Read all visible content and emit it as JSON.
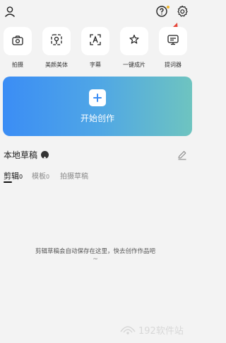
{
  "colors": {
    "background": "#f3f3f3",
    "card_gradient_start": "#3b8df5",
    "card_gradient_end": "#6ec4c0",
    "arrow": "#e5463a",
    "notification_dot": "#f0b52d"
  },
  "top_icons": [
    "user-icon",
    "help-icon",
    "gear-icon"
  ],
  "tools": [
    {
      "label": "拍摄",
      "icon": "camera-icon"
    },
    {
      "label": "美颜美体",
      "icon": "beauty-icon"
    },
    {
      "label": "字幕",
      "icon": "subtitle-icon"
    },
    {
      "label": "一键成片",
      "icon": "magic-icon"
    },
    {
      "label": "提词器",
      "icon": "teleprompter-icon"
    }
  ],
  "create": {
    "label": "开始创作",
    "icon": "plus-icon"
  },
  "drafts": {
    "title": "本地草稿",
    "tabs": [
      {
        "label": "剪辑",
        "count": "0"
      },
      {
        "label": "模板",
        "count": "0"
      },
      {
        "label": "拍摄草稿",
        "count": ""
      }
    ],
    "empty_message": "剪辑草稿会自动保存在这里，快去创作作品吧",
    "empty_tilde": "~"
  },
  "watermark": {
    "text": "192软件站"
  }
}
